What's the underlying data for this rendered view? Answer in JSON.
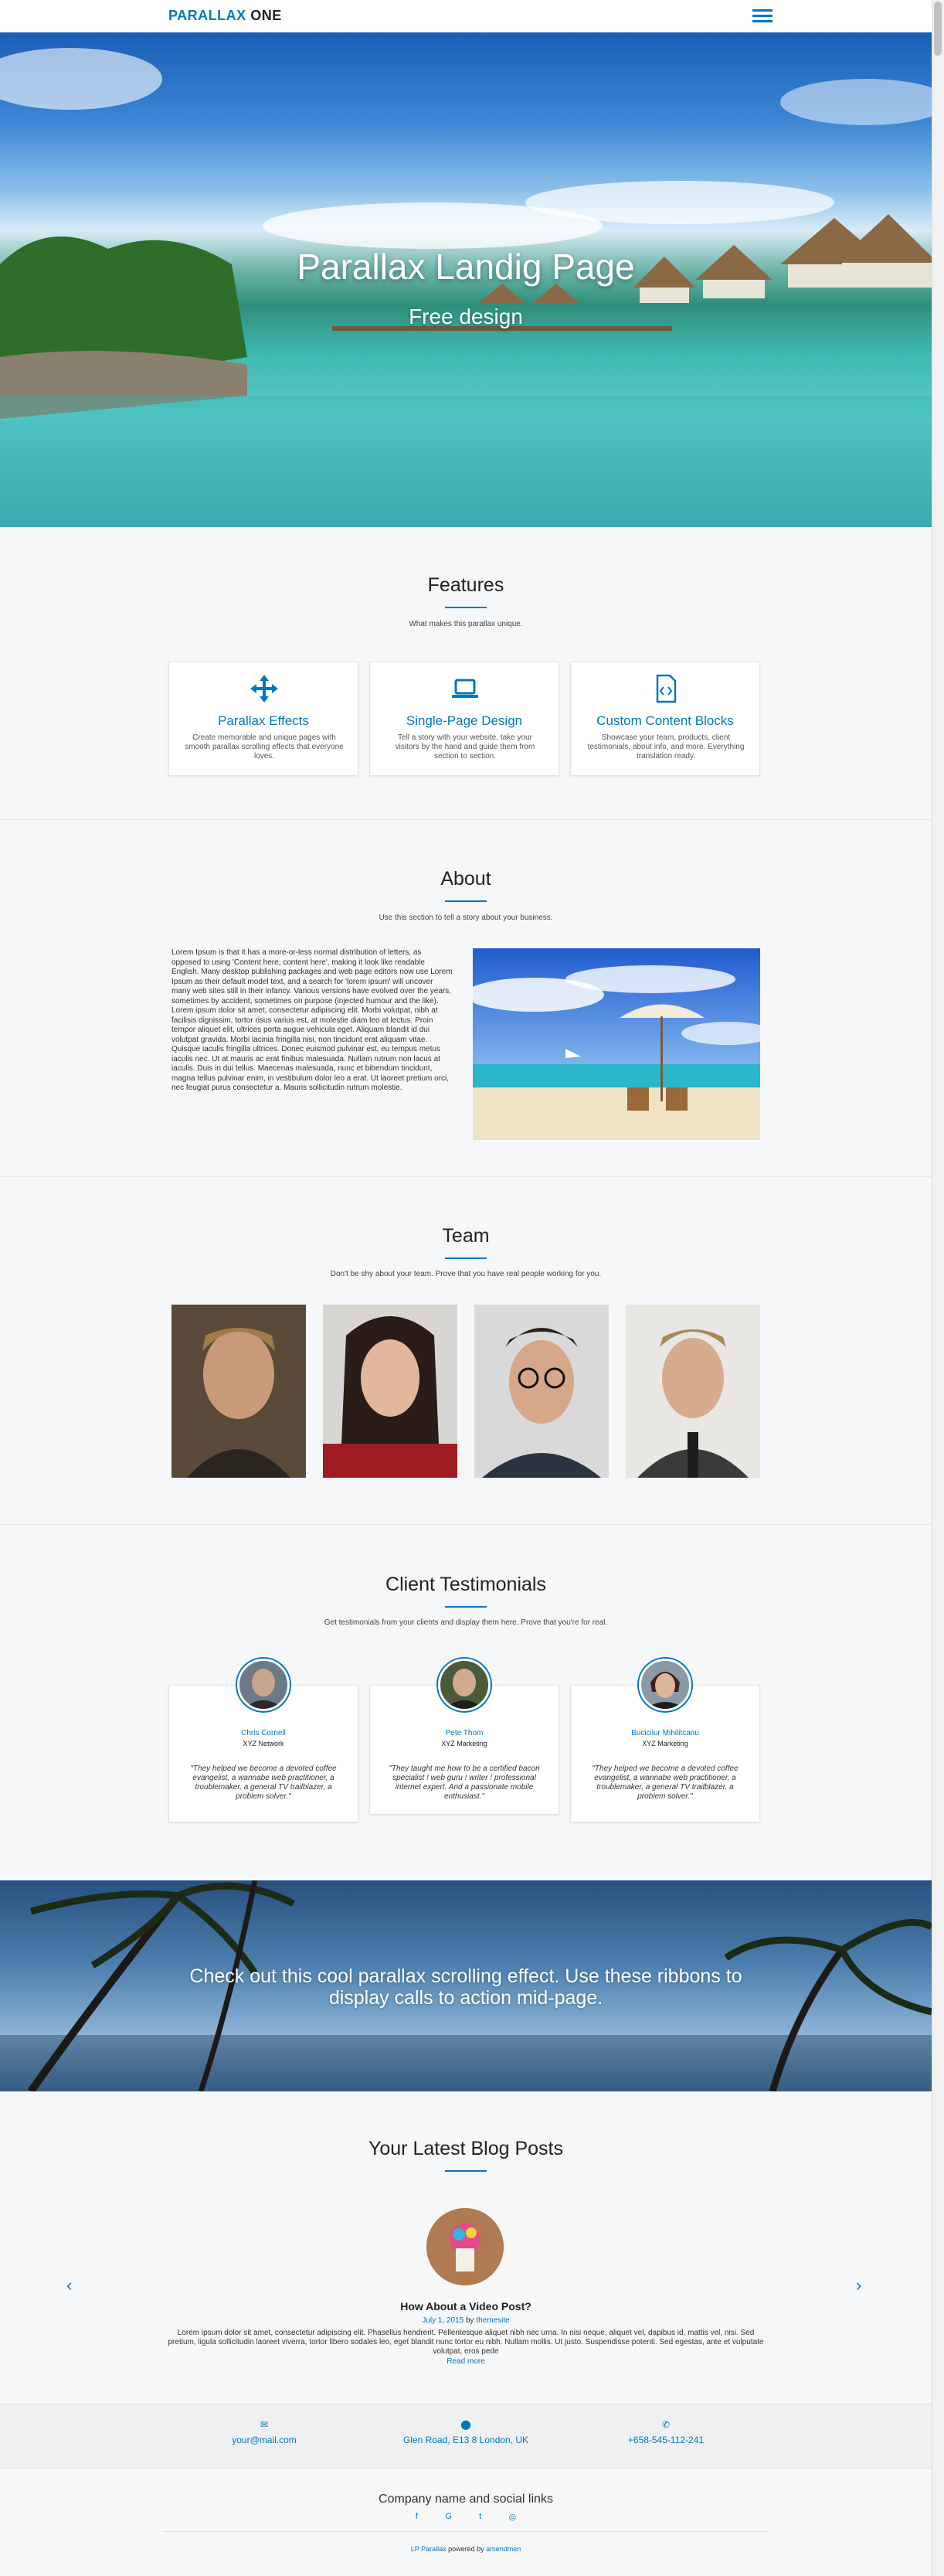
{
  "header": {
    "logo_part1": "PARALLAX",
    "logo_part2": "ONE"
  },
  "hero": {
    "title": "Parallax Landig Page",
    "subtitle": "Free design"
  },
  "features": {
    "title": "Features",
    "subtitle": "What makes this parallax unique.",
    "items": [
      {
        "icon": "arrows-move-icon",
        "title": "Parallax Effects",
        "text": "Create memorable and unique pages with smooth parallax scrolling effects that everyone loves."
      },
      {
        "icon": "laptop-icon",
        "title": "Single-Page Design",
        "text": "Tell a story with your website, take your visitors by the hand and guide them from section to section."
      },
      {
        "icon": "file-code-icon",
        "title": "Custom Content Blocks",
        "text": "Showcase your team, products, client testimonials, about info, and more. Everything translation ready."
      }
    ]
  },
  "about": {
    "title": "About",
    "subtitle": "Use this section to tell a story about your business.",
    "text": "Lorem Ipsum is that it has a more-or-less normal distribution of letters, as opposed to using 'Content here, content here', making it look like readable English. Many desktop publishing packages and web page editors now use Lorem Ipsum as their default model text, and a search for 'lorem ipsum' will uncover many web sites still in their infancy. Various versions have evolved over the years, sometimes by accident, sometimes on purpose (injected humour and the like). Lorem ipsum dolor sit amet, consectetur adipiscing elit. Morbi volutpat, nibh at facilisis dignissim, tortor risus varius est, at molestie diam leo at lectus. Proin tempor aliquet elit, ultrices porta augue vehicula eget. Aliquam blandit id dui volutpat gravida. Morbi lacinia fringilla nisi, non tincidunt erat aliquam vitae. Quisque iaculis fringilla ultrices. Donec euismod pulvinar est, eu tempus metus iaculis nec. Ut at mauris ac erat finibus malesuada. Nullam rutrum non lacus at iaculis. Duis in dui tellus. Maecenas malesuada, nunc et bibendum tincidunt, magna tellus pulvinar enim, in vestibulum dolor leo a erat. Ut laoreet pretium orci, nec feugiat purus consectetur a. Mauris sollicitudin rutrum molestie."
  },
  "team": {
    "title": "Team",
    "subtitle": "Don't be shy about your team. Prove that you have real people working for you."
  },
  "testimonials": {
    "title": "Client Testimonials",
    "subtitle": "Get testimonials from your clients and display them here. Prove that you're for real.",
    "items": [
      {
        "name": "Chris Cornell",
        "role": "XYZ Network",
        "quote": "\"They helped we become a devoted coffee evangelist, a wannabe web practitioner, a troublemaker, a general TV trailblazer, a problem solver.\""
      },
      {
        "name": "Pete Thom",
        "role": "XYZ Marketing",
        "quote": "\"They taught me how to be a certified bacon specialist ! web guru ! writer ! professional internet expert. And a passionate mobile enthusiast.\""
      },
      {
        "name": "Bucicilur Mihilitcanu",
        "role": "XYZ Marketing",
        "quote": "\"They helped we become a devoted coffee evangelist, a wannabe web practitioner, a troublemaker, a general TV trailblazer, a problem solver.\""
      }
    ]
  },
  "cta": {
    "text": "Check out this cool parallax scrolling effect. Use these ribbons to display calls to action mid-page."
  },
  "blog": {
    "title": "Your Latest Blog Posts",
    "post_title": "How About a Video Post?",
    "post_date": "July 1, 2015",
    "post_by": "by",
    "post_author": "themesite",
    "excerpt": "Lorem ipsum dolor sit amet, consectetur adipiscing elit. Phasellus hendrerit. Pellentesque aliquet nibh nec urna. In nisi neque, aliquet vel, dapibus id, mattis vel, nisi. Sed pretium, ligula sollicitudin laoreet viverra, tortor libero sodales leo, eget blandit nunc tortor eu nibh. Nullam mollis. Ut justo. Suspendisse potenti. Sed egestas, ante et vulputate volutpat, eros pede",
    "read_more": "Read more",
    "prev_glyph": "‹",
    "next_glyph": "›"
  },
  "contact": {
    "email": "your@mail.com",
    "address": "Glen Road, E13 8 London, UK",
    "phone": "+658-545-112-241"
  },
  "footer": {
    "company": "Company name and social links",
    "social_icons": [
      "facebook-icon",
      "google-plus-icon",
      "twitter-icon",
      "github-icon"
    ],
    "credit_link": "LP Parallax",
    "credit_middle": " powered by ",
    "credit_author": "amendmen"
  },
  "colors": {
    "accent": "#0078ba",
    "background": "#f6f7f8"
  }
}
